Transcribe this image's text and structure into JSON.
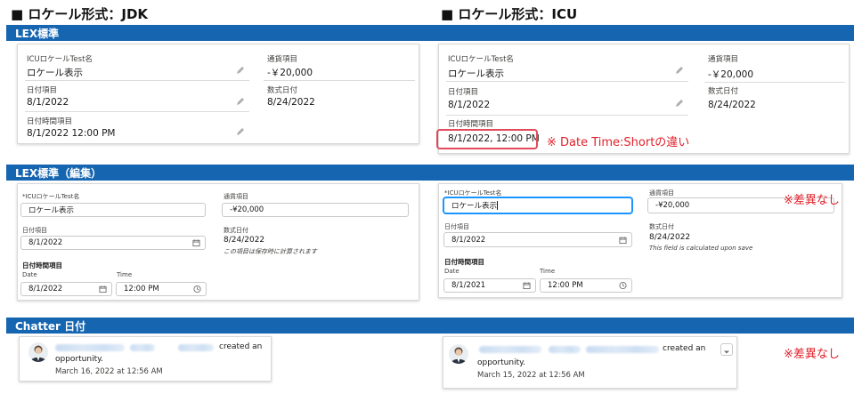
{
  "headers": {
    "left": "■ ロケール形式：JDK",
    "right": "■ ロケール形式：ICU"
  },
  "bands": {
    "lex": "LEX標準",
    "edit": "LEX標準（編集）",
    "chatter": "Chatter 日付"
  },
  "view_jdk": {
    "f1_label": "ICUロケールTest名",
    "f1_value": "ロケール表示",
    "f2_label": "日付項目",
    "f2_value": "8/1/2022",
    "f3_label": "日付時間項目",
    "f3_value": "8/1/2022 12:00 PM",
    "f4_label": "通貨項目",
    "f4_value": "-￥20,000",
    "f5_label": "数式日付",
    "f5_value": "8/24/2022"
  },
  "view_icu": {
    "f1_label": "ICUロケールTest名",
    "f1_value": "ロケール表示",
    "f2_label": "日付項目",
    "f2_value": "8/1/2022",
    "f3_label": "日付時間項目",
    "f3_value": "8/1/2022, 12:00 PM",
    "f4_label": "通貨項目",
    "f4_value": "-￥20,000",
    "f5_label": "数式日付",
    "f5_value": "8/24/2022"
  },
  "edit_jdk": {
    "name_label": "*ICUロケールTest名",
    "name_value": "ロケール表示",
    "currency_label": "通貨項目",
    "currency_value": "-¥20,000",
    "date_label": "日付項目",
    "date_value": "8/1/2022",
    "formula_label": "数式日付",
    "formula_value": "8/24/2022",
    "formula_hint": "この項目は保存時に計算されます",
    "datetime_label": "日付時間項目",
    "date_sub": "Date",
    "time_sub": "Time",
    "dt_date_value": "8/1/2022",
    "dt_time_value": "12:00 PM"
  },
  "edit_icu": {
    "name_label": "*ICUロケールTest名",
    "name_value": "ロケール表示",
    "currency_label": "通貨項目",
    "currency_value": "-¥20,000",
    "date_label": "日付項目",
    "date_value": "8/1/2022",
    "formula_label": "数式日付",
    "formula_value": "8/24/2022",
    "formula_hint": "This field is calculated upon save",
    "datetime_label": "日付時間項目",
    "date_sub": "Date",
    "time_sub": "Time",
    "dt_date_value": "8/1/2021",
    "dt_time_value": "12:00 PM"
  },
  "chatter_jdk": {
    "action": "created an",
    "object": "opportunity.",
    "timestamp": "March 16, 2022 at 12:56 AM"
  },
  "chatter_icu": {
    "action": "created an",
    "object": "opportunity.",
    "timestamp": "March 15, 2022 at 12:56 AM"
  },
  "notes": {
    "difference": "※ Date Time:Shortの違い",
    "no_diff_edit": "※差異なし",
    "no_diff_chatter": "※差異なし"
  },
  "colors": {
    "band": "#1565b0",
    "note": "#e0202a",
    "focus": "#1b96ff"
  }
}
